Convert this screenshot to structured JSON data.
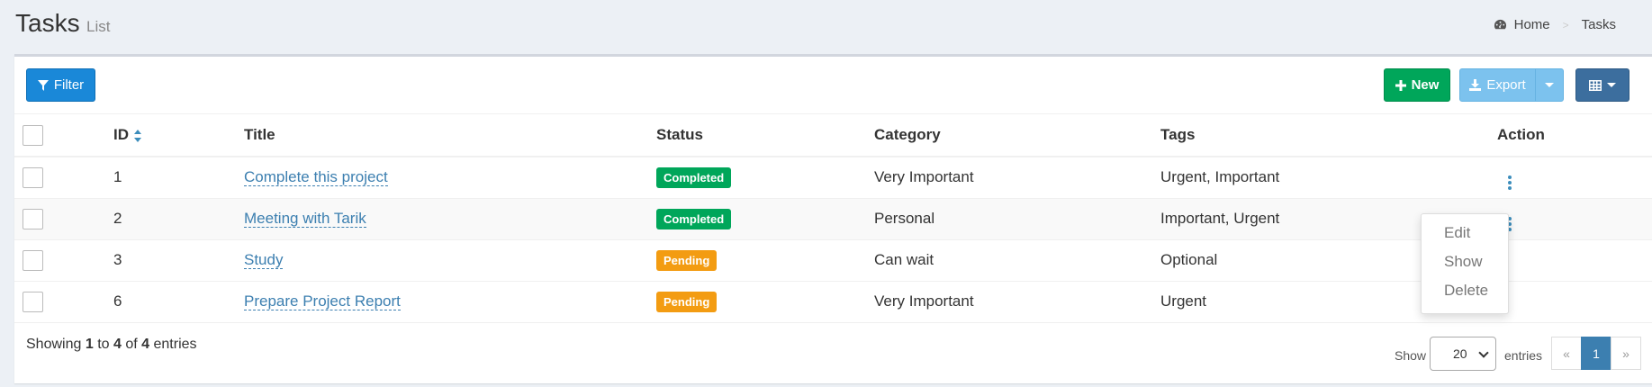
{
  "header": {
    "title": "Tasks",
    "subtitle": "List",
    "breadcrumb": {
      "home": "Home",
      "current": "Tasks"
    }
  },
  "toolbar": {
    "filter_label": "Filter",
    "new_label": "New",
    "export_label": "Export"
  },
  "table": {
    "columns": {
      "id": "ID",
      "title": "Title",
      "status": "Status",
      "category": "Category",
      "tags": "Tags",
      "action": "Action"
    },
    "rows": [
      {
        "id": "1",
        "title": "Complete this project",
        "status": "Completed",
        "category": "Very Important",
        "tags": "Urgent, Important"
      },
      {
        "id": "2",
        "title": "Meeting with Tarik",
        "status": "Completed",
        "category": "Personal",
        "tags": "Important, Urgent"
      },
      {
        "id": "3",
        "title": "Study",
        "status": "Pending",
        "category": "Can wait",
        "tags": "Optional"
      },
      {
        "id": "6",
        "title": "Prepare Project Report",
        "status": "Pending",
        "category": "Very Important",
        "tags": "Urgent"
      }
    ]
  },
  "action_menu": {
    "edit": "Edit",
    "show": "Show",
    "delete": "Delete"
  },
  "footer": {
    "info_prefix": "Showing",
    "info_from": "1",
    "info_to_word": "to",
    "info_to": "4",
    "info_of_word": "of",
    "info_total": "4",
    "info_suffix": "entries",
    "show_label": "Show",
    "page_size": "20",
    "entries_label": "entries",
    "pager": {
      "prev": "«",
      "current": "1",
      "next": "»"
    }
  },
  "colors": {
    "completed": "#00a65a",
    "pending": "#f39c12",
    "primary": "#1a88d8",
    "link": "#3c7fb0"
  }
}
